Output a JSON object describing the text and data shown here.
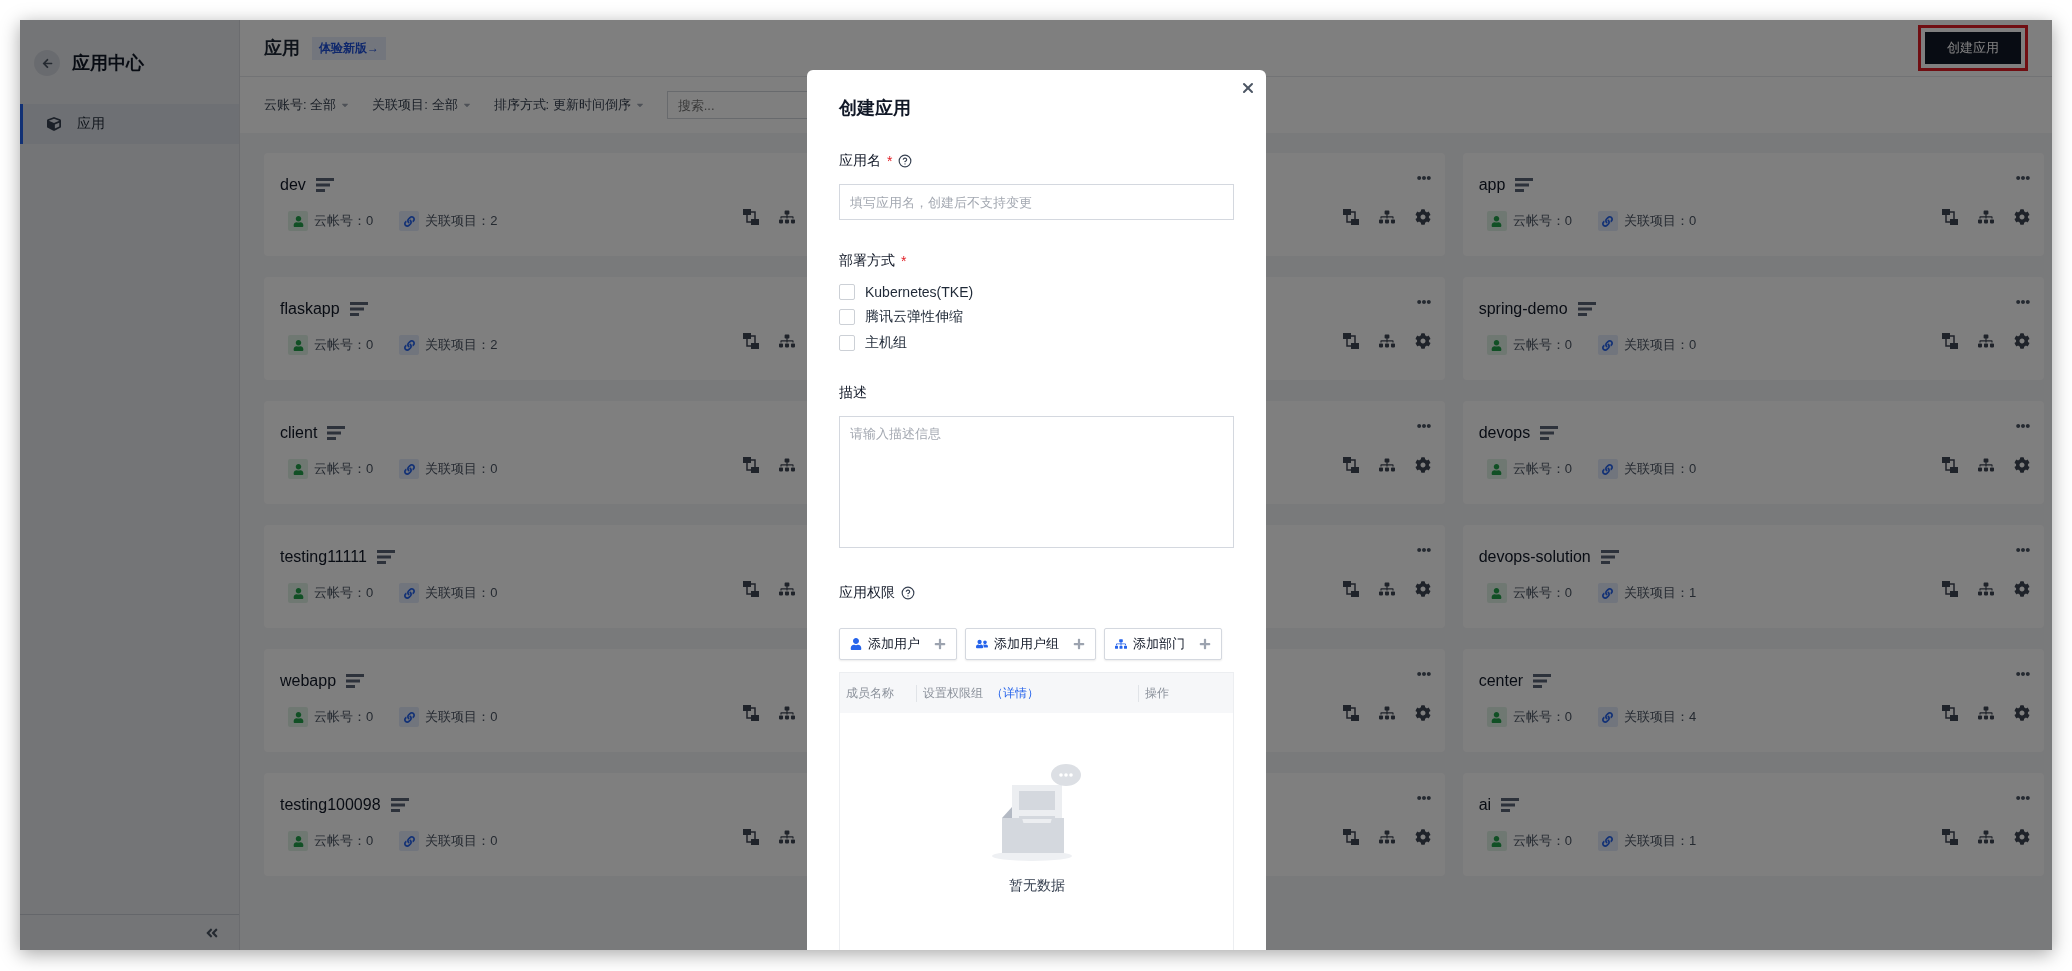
{
  "sidebar": {
    "title": "应用中心",
    "items": [
      {
        "label": "应用",
        "selected": true
      }
    ]
  },
  "header": {
    "title": "应用",
    "badge": "体验新版→",
    "create_button": {
      "label": "创建应用",
      "highlighted": true
    }
  },
  "filters": [
    {
      "label": "云账号:",
      "value": "全部"
    },
    {
      "label": "关联项目:",
      "value": "全部"
    },
    {
      "label": "排序方式:",
      "value": "更新时间倒序"
    }
  ],
  "search": {
    "placeholder": "搜索..."
  },
  "card_columns": [
    {
      "cards": [
        {
          "name": "dev",
          "stats": [
            {
              "kind": "account",
              "text": "云帐号：0"
            },
            {
              "kind": "project",
              "text": "关联项目：2"
            }
          ]
        },
        {
          "name": "flaskapp",
          "stats": [
            {
              "kind": "account",
              "text": "云帐号：0"
            },
            {
              "kind": "project",
              "text": "关联项目：2"
            }
          ]
        },
        {
          "name": "client",
          "stats": [
            {
              "kind": "account",
              "text": "云帐号：0"
            },
            {
              "kind": "project",
              "text": "关联项目：0"
            }
          ]
        },
        {
          "name": "testing11111",
          "stats": [
            {
              "kind": "account",
              "text": "云帐号：0"
            },
            {
              "kind": "project",
              "text": "关联项目：0"
            }
          ]
        },
        {
          "name": "webapp",
          "stats": [
            {
              "kind": "account",
              "text": "云帐号：0"
            },
            {
              "kind": "project",
              "text": "关联项目：0"
            }
          ]
        },
        {
          "name": "testing100098",
          "stats": [
            {
              "kind": "account",
              "text": "云帐号：0"
            },
            {
              "kind": "project",
              "text": "关联项目：0"
            }
          ]
        }
      ]
    },
    {
      "cards": [
        {
          "menu": true
        },
        {
          "menu": true
        },
        {
          "menu": true
        },
        {
          "menu": true
        },
        {
          "menu": true
        },
        {
          "menu": true
        }
      ]
    },
    {
      "cards": [
        {
          "name": "app",
          "menu": true,
          "stats": [
            {
              "kind": "account",
              "text": "云帐号：0"
            },
            {
              "kind": "project",
              "text": "关联项目：0"
            }
          ]
        },
        {
          "name": "spring-demo",
          "menu": true,
          "stats": [
            {
              "kind": "account",
              "text": "云帐号：0"
            },
            {
              "kind": "project",
              "text": "关联项目：0"
            }
          ]
        },
        {
          "name": "devops",
          "menu": true,
          "stats": [
            {
              "kind": "account",
              "text": "云帐号：0"
            },
            {
              "kind": "project",
              "text": "关联项目：0"
            }
          ]
        },
        {
          "name": "devops-solution",
          "menu": true,
          "stats": [
            {
              "kind": "account",
              "text": "云帐号：0"
            },
            {
              "kind": "project",
              "text": "关联项目：1"
            }
          ]
        },
        {
          "name": "center",
          "menu": true,
          "stats": [
            {
              "kind": "account",
              "text": "云帐号：0"
            },
            {
              "kind": "project",
              "text": "关联项目：4"
            }
          ]
        },
        {
          "name": "ai",
          "menu": true,
          "stats": [
            {
              "kind": "account",
              "text": "云帐号：0"
            },
            {
              "kind": "project",
              "text": "关联项目：1"
            }
          ]
        }
      ]
    }
  ],
  "dialog": {
    "title": "创建应用",
    "fields": [
      {
        "kind": "input",
        "label": "应用名",
        "required_mark": "*",
        "help": true,
        "placeholder": "填写应用名，创建后不支持变更"
      },
      {
        "kind": "checkboxes",
        "label": "部署方式",
        "required_mark": "*",
        "options": [
          {
            "label": "Kubernetes(TKE)",
            "checked": false
          },
          {
            "label": "腾讯云弹性伸缩",
            "checked": false
          },
          {
            "label": "主机组",
            "checked": false
          }
        ]
      },
      {
        "kind": "textarea",
        "label": "描述",
        "placeholder": "请输入描述信息"
      },
      {
        "kind": "permissions",
        "label": "应用权限",
        "help": true,
        "buttons": [
          {
            "kind": "user",
            "label": "添加用户"
          },
          {
            "kind": "group",
            "label": "添加用户组"
          },
          {
            "kind": "department",
            "label": "添加部门"
          }
        ],
        "columns": [
          {
            "label": "成员名称"
          },
          {
            "label": "设置权限组",
            "link": "（详情）"
          },
          {
            "label": "操作"
          }
        ],
        "empty_text": "暂无数据"
      }
    ]
  }
}
